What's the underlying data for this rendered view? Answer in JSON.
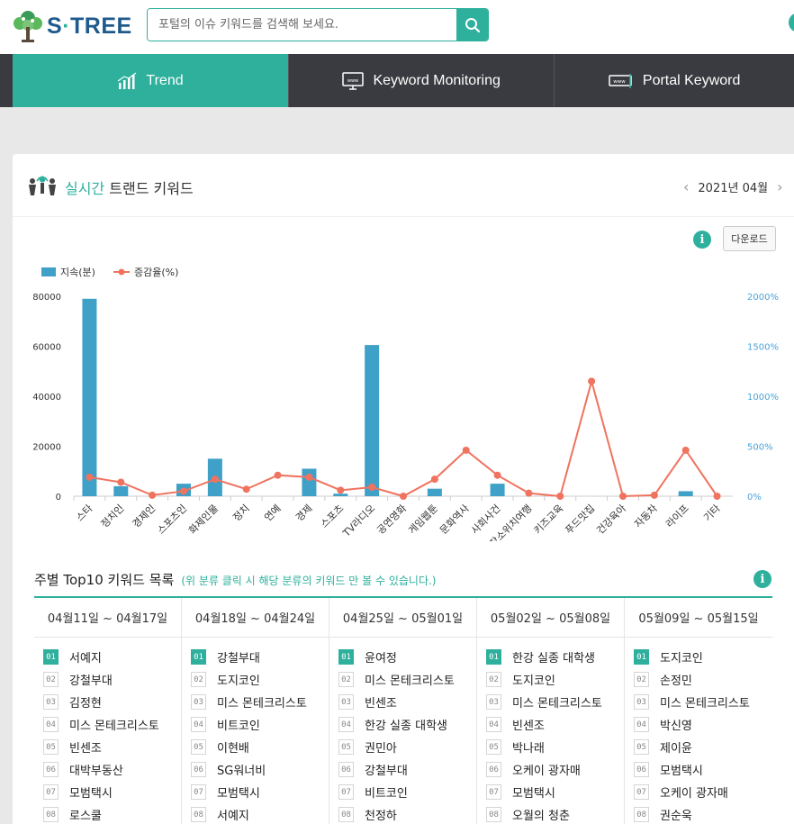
{
  "header": {
    "logo_text": "S·TREE",
    "logo_main": "S",
    "logo_dot": "·",
    "logo_rest": "TREE",
    "search_placeholder": "포털의 이슈 키워드를 검색해 보세요."
  },
  "nav": {
    "tabs": [
      {
        "label": "Trend",
        "icon": "chart-icon",
        "active": true
      },
      {
        "label": "Keyword Monitoring",
        "icon": "monitor-icon",
        "active": false
      },
      {
        "label": "Portal Keyword",
        "icon": "browser-icon",
        "active": false
      }
    ]
  },
  "card": {
    "title_accent": "실시간",
    "title_rest": " 트랜드 키워드",
    "date": "2021년 04월",
    "download_label": "다운로드",
    "accent_color": "#2eb09d"
  },
  "chart_data": {
    "type": "bar",
    "categories": [
      "스타",
      "정치인",
      "경제인",
      "스포츠인",
      "화제인물",
      "정치",
      "연예",
      "경제",
      "스포츠",
      "TV라디오",
      "공연영화",
      "게임웹툰",
      "문화역사",
      "사회사건",
      "장소위치여행",
      "키즈교육",
      "푸드맛집",
      "건강육아",
      "자동차",
      "라이프",
      "기타"
    ],
    "series": [
      {
        "name": "지속(분)",
        "type": "bar",
        "axis": "left",
        "color": "#3fa0c8",
        "values": [
          79000,
          4000,
          0,
          5000,
          15000,
          0,
          0,
          11000,
          1000,
          60500,
          0,
          3000,
          0,
          5000,
          0,
          0,
          0,
          0,
          0,
          2000,
          0
        ]
      },
      {
        "name": "증감율(%)",
        "type": "line",
        "axis": "right",
        "color": "#f0735f",
        "values": [
          190,
          140,
          10,
          50,
          170,
          70,
          210,
          190,
          60,
          90,
          0,
          170,
          460,
          210,
          30,
          0,
          1150,
          0,
          10,
          460,
          0
        ]
      }
    ],
    "left_ticks": [
      "0",
      "20000",
      "40000",
      "60000",
      "80000"
    ],
    "right_ticks": [
      "0%",
      "500%",
      "1000%",
      "1500%",
      "2000%"
    ],
    "left_max": 80000,
    "right_max": 2000,
    "legend_position": "top-left",
    "grid": false
  },
  "weekly": {
    "title": "주별 Top10 키워드 목록",
    "note": "(위 분류 클릭 시 해당 분류의 키워드 만 볼 수 있습니다.)",
    "weeks": [
      {
        "range": "04월11일 ~ 04월17일",
        "items": [
          "서예지",
          "강철부대",
          "김정현",
          "미스 몬테크리스토",
          "빈센조",
          "대박부동산",
          "모범택시",
          "로스쿨"
        ]
      },
      {
        "range": "04월18일 ~ 04월24일",
        "items": [
          "강철부대",
          "도지코인",
          "미스 몬테크리스토",
          "비트코인",
          "이현배",
          "SG워너비",
          "모범택시",
          "서예지"
        ]
      },
      {
        "range": "04월25일 ~ 05월01일",
        "items": [
          "윤여정",
          "미스 몬테크리스토",
          "빈센조",
          "한강 실종 대학생",
          "권민아",
          "강철부대",
          "비트코인",
          "천정하"
        ]
      },
      {
        "range": "05월02일 ~ 05월08일",
        "items": [
          "한강 실종 대학생",
          "도지코인",
          "미스 몬테크리스토",
          "빈센조",
          "박나래",
          "오케이 광자매",
          "모범택시",
          "오월의 청춘"
        ]
      },
      {
        "range": "05월09일 ~ 05월15일",
        "items": [
          "도지코인",
          "손정민",
          "미스 몬테크리스토",
          "박신영",
          "제이윤",
          "모범택시",
          "오케이 광자매",
          "권순욱"
        ]
      }
    ],
    "rank_labels": [
      "01",
      "02",
      "03",
      "04",
      "05",
      "06",
      "07",
      "08"
    ]
  }
}
